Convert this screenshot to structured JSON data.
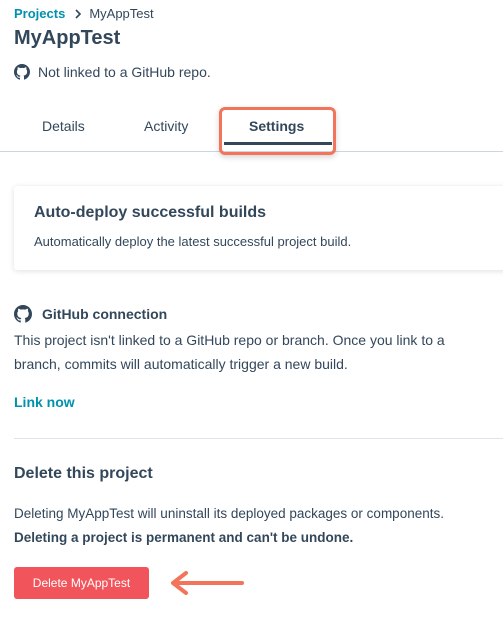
{
  "breadcrumb": {
    "parent": "Projects",
    "separator_icon": "chevron-right-icon",
    "current": "MyAppTest"
  },
  "header": {
    "title": "MyAppTest",
    "repo_status_icon": "github-icon",
    "repo_status": "Not linked to a GitHub repo."
  },
  "tabs": [
    {
      "label": "Details",
      "active": false
    },
    {
      "label": "Activity",
      "active": false
    },
    {
      "label": "Settings",
      "active": true
    }
  ],
  "auto_deploy": {
    "title": "Auto-deploy successful builds",
    "description": "Automatically deploy the latest successful project build."
  },
  "github": {
    "icon": "github-icon",
    "title": "GitHub connection",
    "description": "This project isn't linked to a GitHub repo or branch. Once you link to a branch, commits will automatically trigger a new build.",
    "link_label": "Link now"
  },
  "delete": {
    "title": "Delete this project",
    "description": "Deleting MyAppTest will uninstall its deployed packages or components.",
    "warning": "Deleting a project is permanent and can't be undone.",
    "button_label": "Delete MyAppTest"
  },
  "colors": {
    "link": "#0091ae",
    "text": "#33475b",
    "danger": "#f2545b",
    "annotation": "#f2745b"
  }
}
